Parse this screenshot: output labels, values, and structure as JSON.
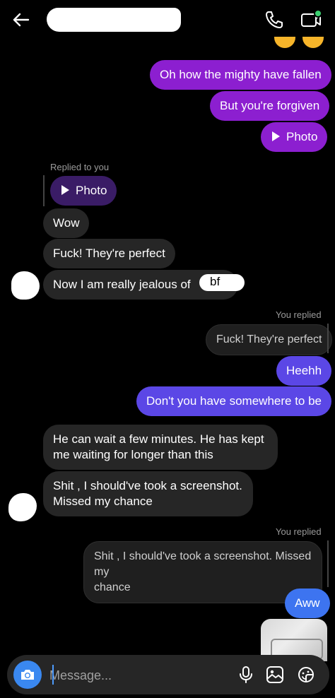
{
  "header": {
    "back_icon": "arrow-left-icon",
    "call_icon": "phone-icon",
    "video_icon": "video-camera-icon",
    "online_dot_color": "#3cd070"
  },
  "messages": {
    "out1": "Oh how the mighty have fallen",
    "out2": "But you're forgiven",
    "out3": "Photo",
    "replied_to_you": "Replied to you",
    "reply_photo": "Photo",
    "in1": "Wow",
    "in2": "Fuck! They're perfect",
    "in3": "Now I am really jealous of",
    "in3_tail": "bf",
    "you_replied_1": "You replied",
    "quote1": "Fuck! They're perfect",
    "out4": "Heehh",
    "out5": "Don't you have somewhere to be",
    "in4_line1": "He can wait a few minutes. He has kept",
    "in4_line2": "me waiting for longer than this",
    "in5_line1": "Shit , I should've took a screenshot.",
    "in5_line2": "Missed my chance",
    "you_replied_2": "You replied",
    "quote2_line1": "Shit , I should've took a screenshot. Missed my",
    "quote2_line2": "chance",
    "out6": "Aww"
  },
  "composer": {
    "placeholder": "Message...",
    "camera_icon": "camera-icon",
    "mic_icon": "microphone-icon",
    "gallery_icon": "image-icon",
    "sticker_icon": "sticker-icon"
  },
  "colors": {
    "bubble_purple": "#8c1fd0",
    "bubble_indigo": "#5b47e6",
    "bubble_blue": "#3d74f0",
    "bubble_incoming": "#262626",
    "camera_blue": "#3a88f0"
  }
}
